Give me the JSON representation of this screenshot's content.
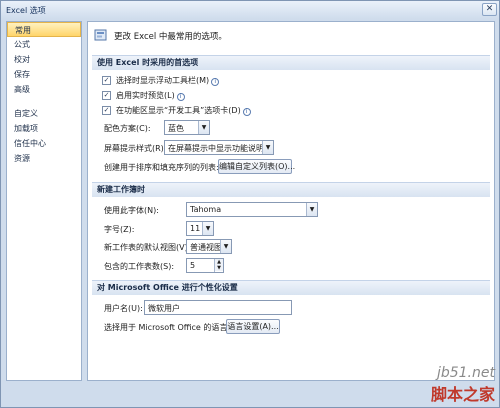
{
  "window": {
    "title": "Excel 选项",
    "close": "✕"
  },
  "nav": {
    "group1": [
      {
        "label": "常用",
        "selected": true
      },
      {
        "label": "公式"
      },
      {
        "label": "校对"
      },
      {
        "label": "保存"
      },
      {
        "label": "高级"
      }
    ],
    "group2": [
      {
        "label": "自定义"
      },
      {
        "label": "加载项"
      },
      {
        "label": "信任中心"
      },
      {
        "label": "资源"
      }
    ]
  },
  "header": {
    "text": "更改 Excel 中最常用的选项。"
  },
  "section1": {
    "title": "使用 Excel 时采用的首选项",
    "options": [
      {
        "label": "选择时显示浮动工具栏(M)",
        "checked": true
      },
      {
        "label": "启用实时预览(L)",
        "checked": true
      },
      {
        "label": "在功能区显示“开发工具”选项卡(D)",
        "checked": true
      }
    ],
    "color_scheme": {
      "label": "配色方案(C):",
      "value": "蓝色"
    },
    "tooltip_style": {
      "label": "屏幕提示样式(R):",
      "value": "在屏幕提示中显示功能说明"
    },
    "custom_lists": {
      "label": "创建用于排序和填充序列的列表:",
      "button": "编辑自定义列表(O)..."
    }
  },
  "section2": {
    "title": "新建工作簿时",
    "font": {
      "label": "使用此字体(N):",
      "value": "Tahoma"
    },
    "size": {
      "label": "字号(Z):",
      "value": "11"
    },
    "view": {
      "label": "新工作表的默认视图(V):",
      "value": "普通视图"
    },
    "sheets": {
      "label": "包含的工作表数(S):",
      "value": "5"
    }
  },
  "section3": {
    "title": "对 Microsoft Office 进行个性化设置",
    "username": {
      "label": "用户名(U):",
      "value": "微软用户"
    },
    "language": {
      "label": "选择用于 Microsoft Office 的语言:",
      "button": "语言设置(A)..."
    }
  },
  "watermark": {
    "line1": "jb51.net",
    "line2": "脚本之家"
  },
  "icons": {
    "info": "info-icon",
    "check": "✓",
    "dropdown": "▼"
  }
}
